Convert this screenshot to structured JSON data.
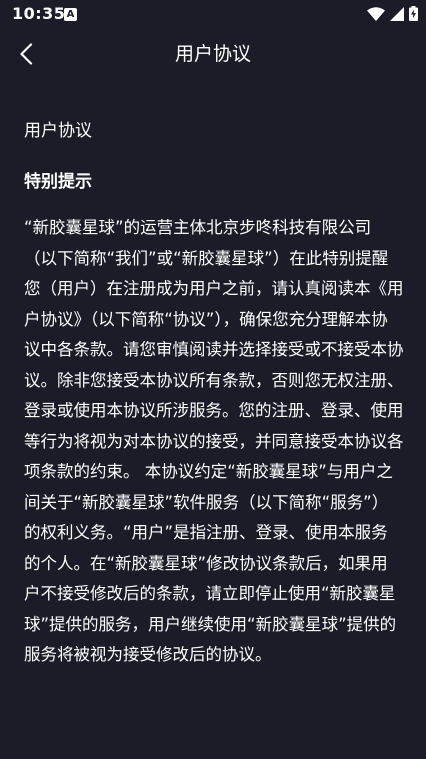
{
  "status_bar": {
    "time": "10:35",
    "notification_letter": "A",
    "icons": [
      "wifi-icon",
      "signal-icon",
      "battery-charging-icon"
    ]
  },
  "nav": {
    "title": "用户协议",
    "back_icon": "chevron-left-icon"
  },
  "content": {
    "heading": "用户协议",
    "section_title": "特别提示",
    "paragraph": "“新胶囊星球”的运营主体北京步咚科技有限公司（以下简称“我们”或“新胶囊星球”）在此特别提醒您（用户）在注册成为用户之前，请认真阅读本《用户协议》（以下简称“协议”），确保您充分理解本协议中各条款。请您审慎阅读并选择接受或不接受本协议。除非您接受本协议所有条款，否则您无权注册、登录或使用本协议所涉服务。您的注册、登录、使用等行为将视为对本协议的接受，并同意接受本协议各项条款的约束。 本协议约定“新胶囊星球”与用户之间关于“新胶囊星球”软件服务（以下简称“服务”）的权利义务。“用户”是指注册、登录、使用本服务的个人。在“新胶囊星球”修改协议条款后，如果用户不接受修改后的条款，请立即停止使用“新胶囊星球”提供的服务，用户继续使用“新胶囊星球”提供的服务将被视为接受修改后的协议。"
  },
  "colors": {
    "background": "#1b1c28",
    "text": "#ffffff"
  }
}
